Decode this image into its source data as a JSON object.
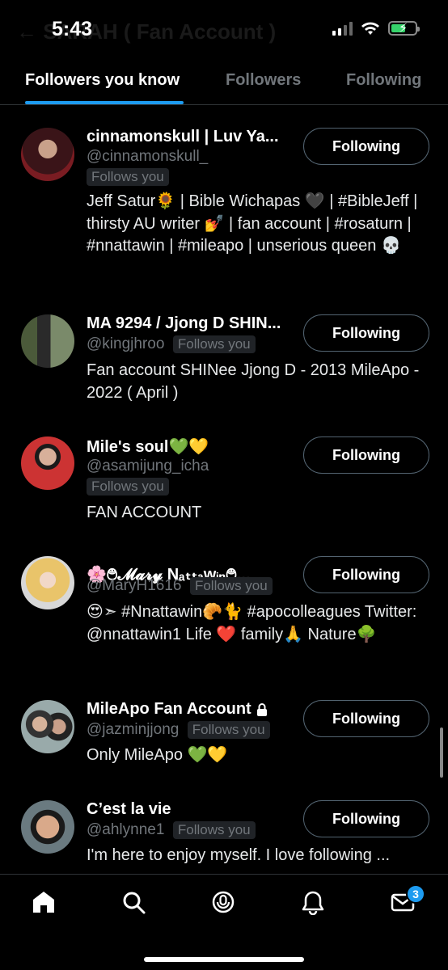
{
  "status": {
    "time": "5:43",
    "ghost_title": "← SARAH ( Fan Account )"
  },
  "tabs": [
    {
      "label": "Followers you know",
      "active": true
    },
    {
      "label": "Followers",
      "active": false
    },
    {
      "label": "Following",
      "active": false
    }
  ],
  "users": [
    {
      "name": "cinnamonskull | Luv Ya...",
      "handle": "@cinnamonskull_",
      "badge": "Follows you",
      "bio": "Jeff Satur🌻 | Bible Wichapas 🖤 | #BibleJeff | thirsty AU writer 💅 | fan account | #rosaturn | #nnattawin | #mileapo | unserious queen 💀",
      "button": "Following"
    },
    {
      "name": "MA 9294 / Jjong D SHIN...",
      "handle": "@kingjhroo",
      "badge": "Follows you",
      "bio": "Fan account SHINee Jjong D - 2013 MileApo - 2022 ( April )",
      "button": "Following"
    },
    {
      "name": "Mile's soul💚💛",
      "handle": "@asamijung_icha",
      "badge": "Follows you",
      "bio": "FAN ACCOUNT",
      "button": "Following"
    },
    {
      "name": "🌸࿉𝓜𝓪𝓻𝔂 Nₐₜₜₐwᵢₙ࿉...",
      "handle": "@MaryH1616",
      "badge": "Follows you",
      "bio": "😍➣ #Nnattawin🥐🐈 #apocolleagues Twitter: @nnattawin1 Life ❤️ family🙏 Nature🌳",
      "button": "Following"
    },
    {
      "name": "MileApo Fan Account",
      "handle": "@jazminjjong",
      "badge": "Follows you",
      "bio": "Only MileApo 💚💛",
      "button": "Following"
    },
    {
      "name": "C’est la vie",
      "handle": "@ahlynne1",
      "badge": "Follows you",
      "bio": "I'm here to enjoy myself. I love following ...",
      "button": "Following"
    }
  ],
  "nav": {
    "notifications_count": "3"
  },
  "colors": {
    "accent": "#1d9bf0",
    "background": "#000000",
    "muted": "#71767b"
  },
  "icons": [
    "home-icon",
    "search-icon",
    "spaces-icon",
    "bell-icon",
    "mail-icon",
    "lock-icon"
  ]
}
